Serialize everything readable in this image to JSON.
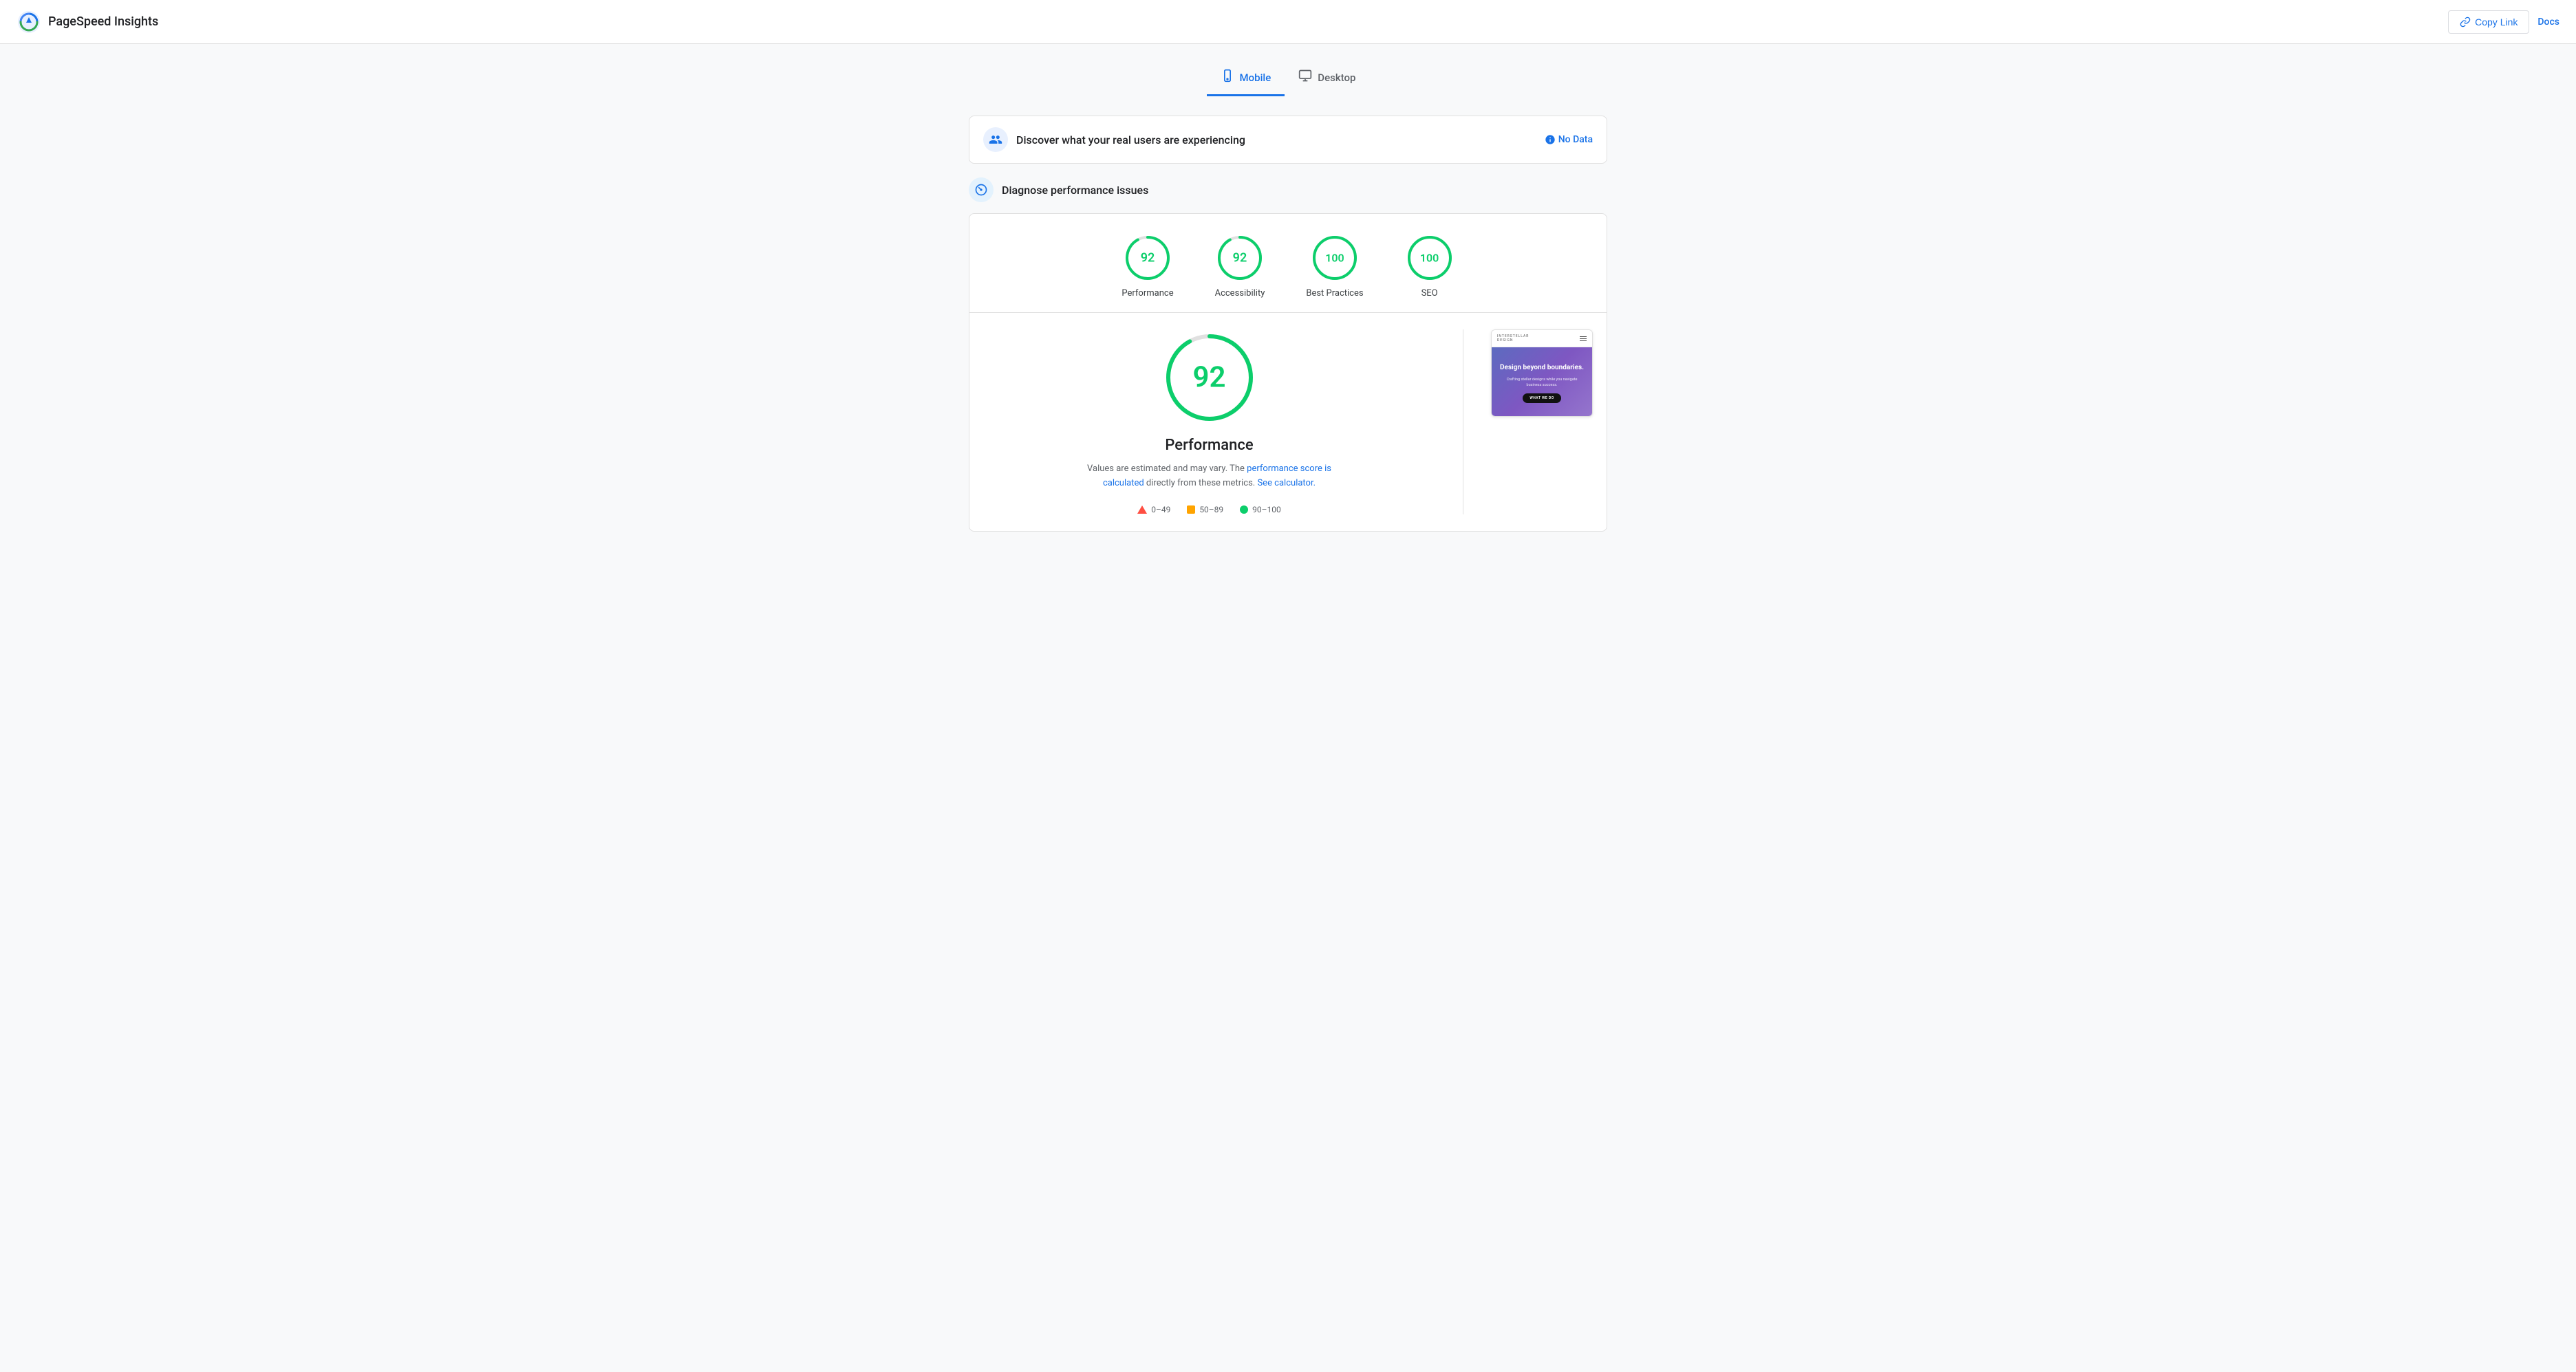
{
  "header": {
    "title": "PageSpeed Insights",
    "copy_link_label": "Copy Link",
    "docs_label": "Docs"
  },
  "tabs": [
    {
      "id": "mobile",
      "label": "Mobile",
      "icon": "📱",
      "active": true
    },
    {
      "id": "desktop",
      "label": "Desktop",
      "icon": "🖥",
      "active": false
    }
  ],
  "real_users_section": {
    "title": "Discover what your real users are experiencing",
    "no_data_label": "No Data"
  },
  "diagnose_section": {
    "title": "Diagnose performance issues"
  },
  "scores": [
    {
      "id": "performance",
      "label": "Performance",
      "value": 92,
      "color": "#0cce6b",
      "circumference": 201.06,
      "offset": 16.09
    },
    {
      "id": "accessibility",
      "label": "Accessibility",
      "value": 92,
      "color": "#0cce6b",
      "circumference": 201.06,
      "offset": 16.09
    },
    {
      "id": "best-practices",
      "label": "Best Practices",
      "value": 100,
      "color": "#0cce6b",
      "circumference": 201.06,
      "offset": 0
    },
    {
      "id": "seo",
      "label": "SEO",
      "value": 100,
      "color": "#0cce6b",
      "circumference": 201.06,
      "offset": 0
    }
  ],
  "detail": {
    "score_value": "92",
    "title": "Performance",
    "description_prefix": "Values are estimated and may vary. The",
    "description_link1": "performance score is calculated",
    "description_middle": "directly from these metrics.",
    "description_link2": "See calculator.",
    "big_circumference": 408.41,
    "big_offset": 32.67
  },
  "legend": [
    {
      "id": "poor",
      "range": "0–49",
      "type": "triangle"
    },
    {
      "id": "average",
      "range": "50–89",
      "type": "square"
    },
    {
      "id": "good",
      "range": "90–100",
      "type": "dot"
    }
  ],
  "screenshot": {
    "logo_line1": "INTERSTELLAR",
    "logo_line2": "DESIGN",
    "headline": "Design beyond boundaries.",
    "sub": "Crafting stellar designs while you navigate business success.",
    "cta": "WHAT WE DO"
  },
  "colors": {
    "accent": "#1a73e8",
    "green": "#0cce6b",
    "orange": "#ffa400",
    "red": "#ff4e42"
  }
}
